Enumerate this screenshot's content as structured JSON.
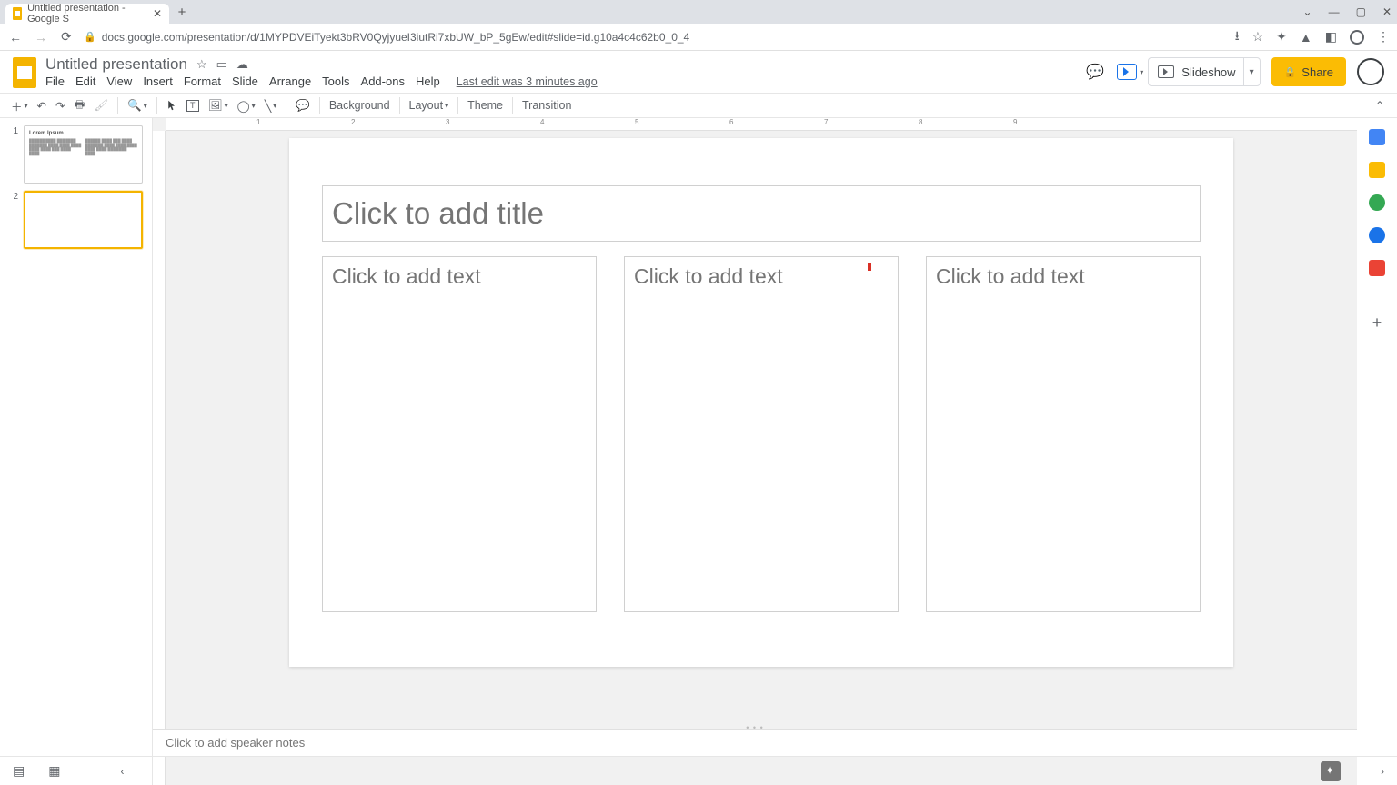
{
  "browser": {
    "tab_title": "Untitled presentation - Google S",
    "url": "docs.google.com/presentation/d/1MYPDVEiTyekt3bRV0QyjyueI3iutRi7xbUW_bP_5gEw/edit#slide=id.g10a4c4c62b0_0_4"
  },
  "doc": {
    "title": "Untitled presentation",
    "last_edit": "Last edit was 3 minutes ago"
  },
  "menus": [
    "File",
    "Edit",
    "View",
    "Insert",
    "Format",
    "Slide",
    "Arrange",
    "Tools",
    "Add-ons",
    "Help"
  ],
  "header_buttons": {
    "slideshow": "Slideshow",
    "share": "Share"
  },
  "toolbar": {
    "background": "Background",
    "layout": "Layout",
    "theme": "Theme",
    "transition": "Transition"
  },
  "ruler": [
    "1",
    "2",
    "3",
    "4",
    "5",
    "6",
    "7",
    "8",
    "9"
  ],
  "filmstrip": {
    "slide1": {
      "num": "1",
      "title": "Lorem Ipsum"
    },
    "slide2": {
      "num": "2"
    }
  },
  "slide": {
    "title_placeholder": "Click to add title",
    "text_placeholder_1": "Click to add text",
    "text_placeholder_2": "Click to add text",
    "text_placeholder_3": "Click to add text"
  },
  "notes_placeholder": "Click to add speaker notes"
}
